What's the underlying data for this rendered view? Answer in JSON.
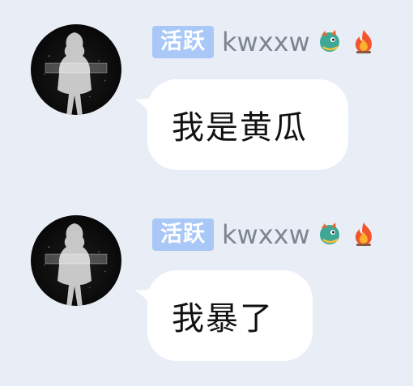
{
  "messages": [
    {
      "badge": "活跃",
      "username": "kwxxw",
      "text": "我是黄瓜",
      "emoji_icons": [
        "dragon-icon",
        "fire-icon"
      ]
    },
    {
      "badge": "活跃",
      "username": "kwxxw",
      "text": "我暴了",
      "emoji_icons": [
        "dragon-icon",
        "fire-icon"
      ]
    }
  ],
  "colors": {
    "background": "#e9edf6",
    "badge": "#a9c8f7",
    "username": "#7d8591",
    "bubble": "#ffffff",
    "text": "#111111"
  }
}
